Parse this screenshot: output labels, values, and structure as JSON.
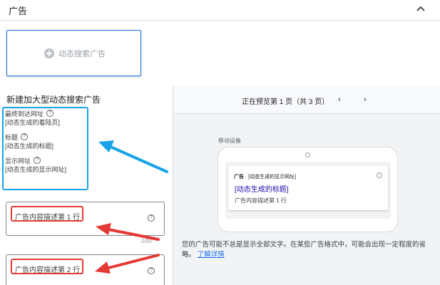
{
  "header": {
    "title": "广告",
    "collapse_icon": "chevron-up-icon"
  },
  "ad_card": {
    "label": "动态搜索广告",
    "icon": "plus-circle-icon"
  },
  "form": {
    "title": "新建加大型动态搜索广告",
    "fields": [
      {
        "label": "最终到达网址",
        "value": "[动态生成的着陆页]"
      },
      {
        "label": "标题",
        "value": "[动态生成的标题]"
      },
      {
        "label": "显示网址",
        "value": "[动态生成的显示网址]"
      }
    ],
    "description1": {
      "placeholder": "广告内容描述第 1 行",
      "counter": "0/90"
    },
    "description2": {
      "placeholder": "广告内容描述第 2 行"
    }
  },
  "preview": {
    "page_text": "正在预览第 1 页（共 3 页）",
    "prev_label": "‹",
    "next_label": "›",
    "device_label": "移动设备",
    "ad": {
      "badge": "广告",
      "separator": " · ",
      "display_url": "[动态生成的显示网址]",
      "headline": "[动态生成的标题]",
      "description": "广告内容描述第 1 行"
    },
    "note": "您的广告可能不总是显示全部文字。在某些广告格式中，可能会出现一定程度的省略。",
    "note_link": "了解详情"
  },
  "colors": {
    "accent_blue": "#1a73e8",
    "annotation_blue": "#1aa3e8",
    "annotation_red": "#e53935"
  }
}
